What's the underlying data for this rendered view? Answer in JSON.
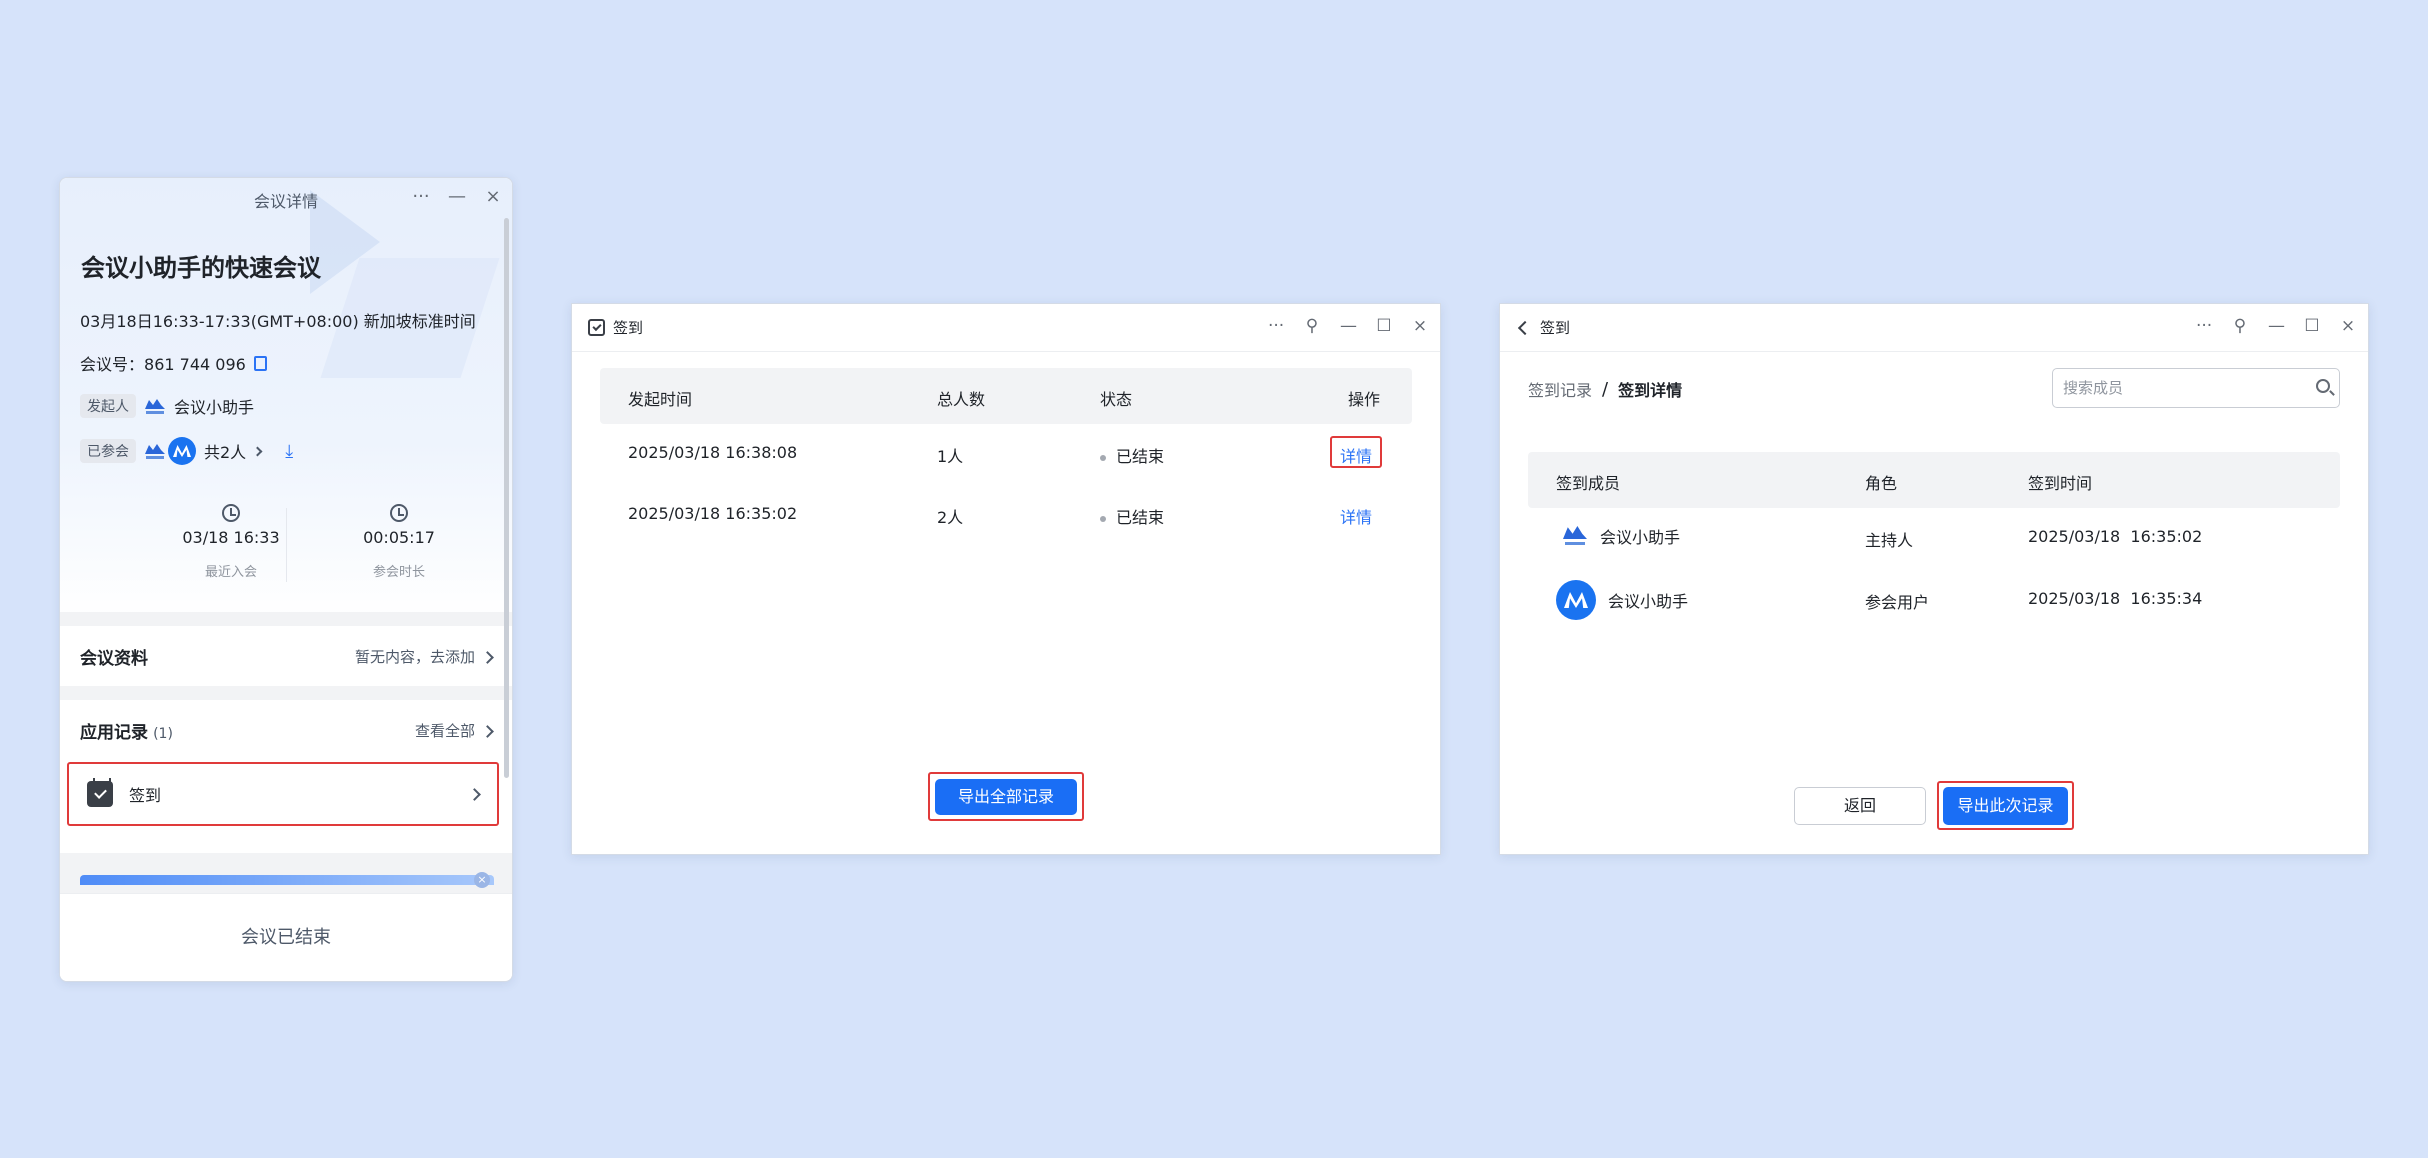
{
  "meeting_window": {
    "title": "会议详情",
    "controls": [
      "···",
      "—",
      "×"
    ],
    "meeting_title": "会议小助手的快速会议",
    "time_line": "03月18日16:33-17:33(GMT+08:00) 新加坡标准时间",
    "meeting_id_label": "会议号：",
    "meeting_id": "861 744 096",
    "initiator_tag": "发起人",
    "initiator_name": "会议小助手",
    "attended_tag": "已参会",
    "attended_count": "共2人",
    "last_join_time": "03/18 16:33",
    "last_join_label": "最近入会",
    "duration": "00:05:17",
    "duration_label": "参会时长",
    "materials_label": "会议资料",
    "materials_hint": "暂无内容，去添加",
    "app_records_label": "应用记录",
    "app_records_count": "(1)",
    "view_all": "查看全部",
    "signin_item": "签到",
    "banner_close": "×",
    "footer": "会议已结束"
  },
  "records_window": {
    "title": "签到",
    "controls": [
      "···",
      "⚲",
      "—",
      "☐",
      "×"
    ],
    "columns": [
      "发起时间",
      "总人数",
      "状态",
      "操作"
    ],
    "rows": [
      {
        "time": "2025/03/18 16:38:08",
        "count": "1人",
        "status": "已结束",
        "action": "详情"
      },
      {
        "time": "2025/03/18 16:35:02",
        "count": "2人",
        "status": "已结束",
        "action": "详情"
      }
    ],
    "export_all": "导出全部记录"
  },
  "detail_window": {
    "title": "签到",
    "controls": [
      "···",
      "⚲",
      "—",
      "☐",
      "×"
    ],
    "breadcrumb_parent": "签到记录",
    "breadcrumb_sep": "/",
    "breadcrumb_current": "签到详情",
    "search_placeholder": "搜索成员",
    "columns": [
      "签到成员",
      "角色",
      "签到时间"
    ],
    "rows": [
      {
        "name": "会议小助手",
        "role": "主持人",
        "time": "2025/03/18  16:35:02",
        "avatar": "logo"
      },
      {
        "name": "会议小助手",
        "role": "参会用户",
        "time": "2025/03/18  16:35:34",
        "avatar": "blue-circle"
      }
    ],
    "back_label": "返回",
    "export_this": "导出此次记录"
  },
  "colors": {
    "background": "#d6e3fa",
    "primary": "#1a6ef5",
    "highlight": "#e03a3a"
  }
}
